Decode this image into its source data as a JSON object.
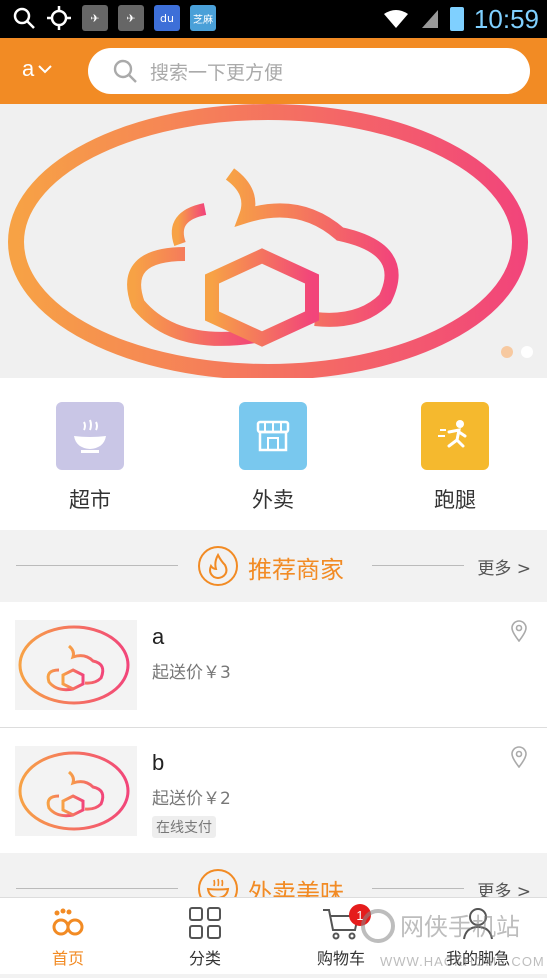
{
  "status_bar": {
    "time": "10:59",
    "badges": [
      "du",
      "芝麻"
    ]
  },
  "header": {
    "city": "a",
    "search_placeholder": "搜索一下更方便"
  },
  "categories": [
    {
      "label": "超市",
      "color": "#c9c6e6",
      "icon": "bowl-icon"
    },
    {
      "label": "外卖",
      "color": "#79c8ee",
      "icon": "store-icon"
    },
    {
      "label": "跑腿",
      "color": "#f5b92e",
      "icon": "runner-icon"
    }
  ],
  "section_recommended": {
    "title": "推荐商家",
    "more": "更多 >"
  },
  "shops": [
    {
      "name": "a",
      "min_price": "起送价￥3",
      "tag": ""
    },
    {
      "name": "b",
      "min_price": "起送价￥2",
      "tag": "在线支付"
    }
  ],
  "section_takeout": {
    "title": "外卖美味",
    "more": "更多 >"
  },
  "tabs": [
    {
      "label": "首页",
      "active": true,
      "icon": "home-icon"
    },
    {
      "label": "分类",
      "active": false,
      "icon": "grid-icon"
    },
    {
      "label": "购物车",
      "active": false,
      "icon": "cart-icon",
      "badge": "1"
    },
    {
      "label": "我的脚急",
      "active": false,
      "icon": "user-icon"
    }
  ],
  "watermark": {
    "text": "网侠手机站",
    "url": "WWW.HACKHOME.COM"
  },
  "colors": {
    "accent": "#f28b24",
    "badge": "#e51c1c"
  }
}
